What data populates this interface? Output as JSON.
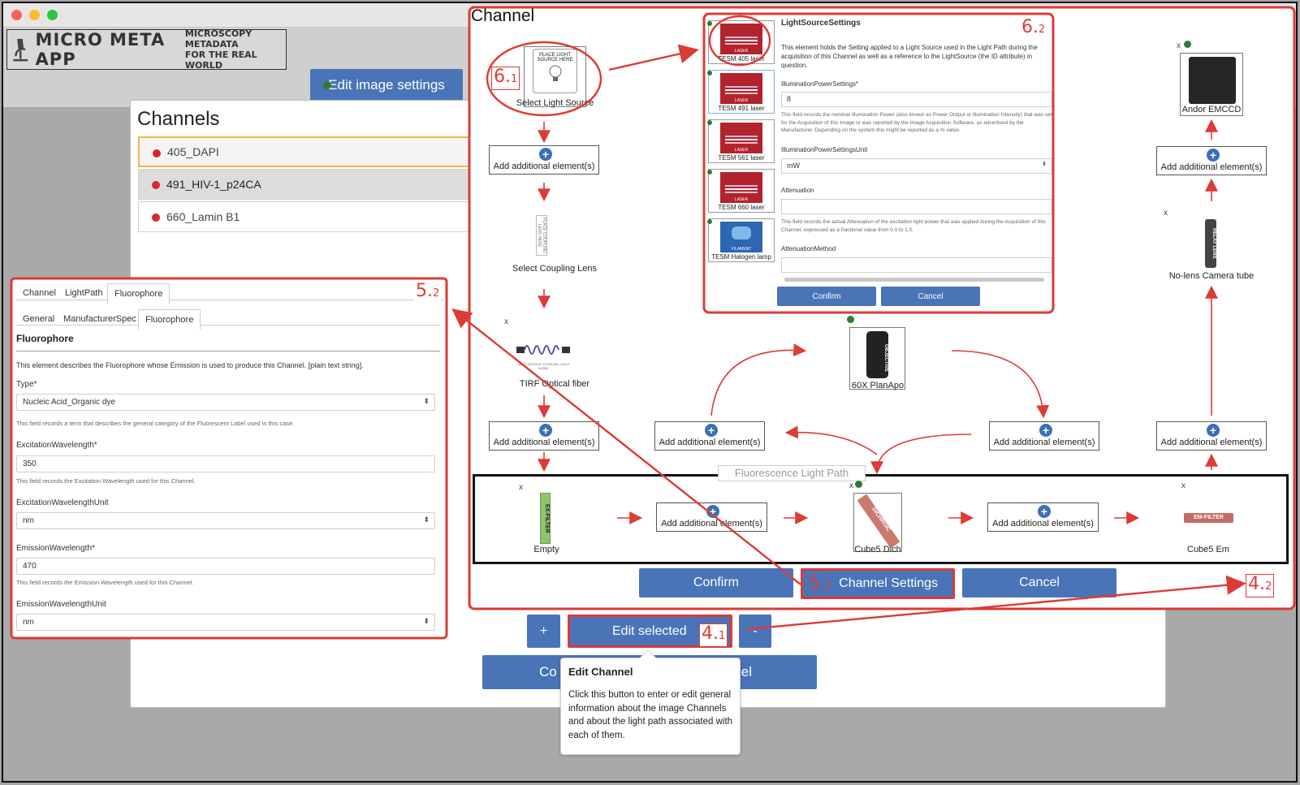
{
  "app": {
    "logo_title": "MICRO META APP",
    "logo_tagline_1": "MICROSCOPY METADATA",
    "logo_tagline_2": "FOR THE REAL WORLD",
    "edit_image_settings": "Edit image settings"
  },
  "channels_modal": {
    "title": "Channels",
    "items": [
      {
        "label": "405_DAPI"
      },
      {
        "label": "491_HIV-1_p24CA"
      },
      {
        "label": "660_Lamin B1"
      }
    ],
    "plus_label": "+",
    "minus_label": "-",
    "edit_selected_label": "Edit selected",
    "confirm_partial": "Co",
    "cancel_partial": "cel"
  },
  "tooltip": {
    "title": "Edit Channel",
    "body": "Click this button to enter or edit general information about the image Channels and about the light path associated with each of them."
  },
  "fluorophore_panel": {
    "tabs": [
      "Channel",
      "LightPath",
      "Fluorophore"
    ],
    "subtabs": [
      "General",
      "ManufacturerSpec",
      "Fluorophore"
    ],
    "heading": "Fluorophore",
    "description": "This element describes the Fluorophore whose Emission is used to produce this Channel. [plain text string].",
    "type_label": "Type*",
    "type_value": "Nucleic Acid_Organic dye",
    "type_help": "This field records a term that describes the general category of the Fluorescent Label used in this case.",
    "exc_label": "ExcitationWavelength*",
    "exc_value": "350",
    "exc_help": "This field records the Excitation Wavelength used for this Channel.",
    "exc_unit_label": "ExcitationWavelengthUnit",
    "exc_unit_value": "nm",
    "em_label": "EmissionWavelength*",
    "em_value": "470",
    "em_help": "This field records the Emission Wavelength used for this Channel.",
    "em_unit_label": "EmissionWavelengthUnit",
    "em_unit_value": "nm"
  },
  "channel_panel": {
    "title": "Channel",
    "select_light_source": "Select Light Source",
    "light_source_place_text": "PLACE LIGHT SOURCE HERE",
    "add_element": "Add additional element(s)",
    "select_coupling_lens": "Select Coupling Lens",
    "coupling_lens_place_text": "PLACE COUPLING LENS HERE",
    "fiber_caption": "TIRF Optical fiber",
    "fiber_subtext": "LIGHT SOURCE COUPLING LIGHT GUIDE",
    "objective_caption": "60X PlanApo",
    "objective_icon_text": "OBJECTIVE",
    "camera_caption": "Andor EMCCD",
    "tube_caption": "No-lens Camera tube",
    "tube_icon_text": "RELAY LENS",
    "light_path_label": "Fluorescence Light Path",
    "exfilter_caption": "Empty",
    "exfilter_icon_text": "EX-FILTER",
    "dichroic_caption": "Cube5 Dich",
    "dichroic_icon_text": "DICHROIC",
    "emfilter_caption": "Cube5 Em",
    "emfilter_icon_text": "EM-FILTER",
    "x_mark": "x",
    "confirm": "Confirm",
    "channel_settings": "Channel Settings",
    "cancel": "Cancel"
  },
  "light_source_settings": {
    "title": "LightSourceSettings",
    "description": "This element holds the Setting applied to a Light Source used in the Light Path during the acquisition of this Channel as well as a reference to the LightSource (the ID attribute) in question.",
    "power_label": "IlluminationPowerSettings*",
    "power_value": "8",
    "power_help": "This field records the nominal Illumination Power (also known as Power Output or Illumination Intensity) that was set for the Acquisition of this Image or was reported by the Image Acquisition Software, as advertised by the Manufacturer. Depending on the system this might be reported as a % value.",
    "unit_label": "IlluminationPowerSettingsUnit",
    "unit_value": "mW",
    "att_label": "Attenuation",
    "att_help": "This field records the actual Attenuation of the excitation light power that was applied during the Acquisition of this Channel, expressed as a fractional value from 0.0 to 1.0.",
    "attm_label": "AttenuationMethod",
    "confirm": "Confirm",
    "cancel": "Cancel",
    "laser_icon_text": "LASER",
    "halogen_icon_text": "FILAMENT",
    "sources": [
      {
        "caption": "TESM 405 laser"
      },
      {
        "caption": "TESM 491 laser"
      },
      {
        "caption": "TESM 561 laser"
      },
      {
        "caption": "TESM 660 laser"
      },
      {
        "caption": "TESM Halogen lamp"
      }
    ]
  },
  "annotations": {
    "a41": {
      "num": "4.",
      "sub": "1"
    },
    "a42": {
      "num": "4.",
      "sub": "2"
    },
    "a51": {
      "num": "5.",
      "sub": "1"
    },
    "a52": {
      "num": "5.",
      "sub": "2"
    },
    "a61": {
      "num": "6.",
      "sub": "1"
    },
    "a62": {
      "num": "6.",
      "sub": "2"
    }
  },
  "colors": {
    "accent_blue": "#4a74b8",
    "annotation_red": "#dc3b36",
    "status_red": "#d8262b",
    "status_green": "#2f7b35"
  }
}
